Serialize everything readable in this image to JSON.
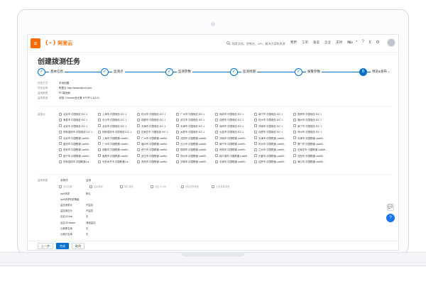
{
  "topbar": {
    "menu_icon": "≡",
    "logo_mark": "(-)",
    "logo_text": "阿里云",
    "search_placeholder": "搜索文档、控制台、API、解决方案和资源",
    "nav": [
      "费用",
      "工单",
      "备案",
      "企业",
      "支持",
      "App"
    ],
    "icons": [
      "message-icon",
      "notification-icon",
      "help-icon",
      "cart-icon",
      "settings-icon"
    ]
  },
  "page": {
    "title": "创建拨测任务"
  },
  "steps": [
    {
      "num": "✓",
      "label": "基本信息",
      "state": "done"
    },
    {
      "num": "✓",
      "label": "监测点",
      "state": "done"
    },
    {
      "num": "✓",
      "label": "监测参数",
      "state": "done"
    },
    {
      "num": "✓",
      "label": "监测周期",
      "state": "done"
    },
    {
      "num": "✓",
      "label": "报警参数",
      "state": "done"
    },
    {
      "num": "6",
      "label": "预览&发布",
      "state": "active"
    }
  ],
  "info": [
    {
      "key": "任务方式",
      "value": "手动创建"
    },
    {
      "key": "任务名称",
      "value": "阿里云 http://www.aliyun.com"
    },
    {
      "key": "监测类型",
      "value": "PC端页面"
    },
    {
      "key": "监测类型",
      "value": "浏览: Chrome全元素 HTTP/1.1(3.0)"
    }
  ],
  "locations_label": "监测点",
  "locations": [
    [
      "北京市 中国电信 IDC 1",
      "上海市 中国电信 IDC 1",
      "杭州市 中国电信 IDC 1",
      "广州市 中国电信 IDC 1",
      "深圳市 中国电信 IDC 1",
      "南宁市 中国电信 IDC 1",
      "昆明市 中国电信 IDC 1"
    ],
    [
      "海县市 中国电信 IDC 1",
      "长沙市 中国电信 IDC 1",
      "成都市 中国电信 IDC 1",
      "武汉市 中国电信 IDC 1",
      "合肥市 中国电信 IDC 1",
      "杭州市 中国电信 IDC 1",
      "福州市 中国电信 IDC 1"
    ],
    [
      "北京市 中国电信 IDC 1",
      "北京市 中国电信 IDC 1",
      "天津市 中国电信 IDC 1",
      "天津市 中国电信 IDC 1",
      "深圳市 中国电信 IDC 1",
      "济南市 中国电信 IDC 1",
      "南宁市 中国电信 IDC 1"
    ],
    [
      "呼和浩特市 中国电信 IDC 1",
      "呼和浩特市 中国电信 IDC 1",
      "石家庄市 中国电信 IDC 1",
      "太原市 中国电信 IDC 1",
      "大连市 中国电信 IDC 1",
      "合肥市 中国电信 IDC 1",
      "郑州市 中国电信 IDC 1"
    ],
    [
      "北京市 中国联通 LastMi...",
      "上海市 中国联通 LastMi...",
      "广州市 中国联通 LastMi...",
      "沈阳市 中国联通 LastMi...",
      "济南市 中国联通 LastMi...",
      "天津市 中国联通 LastMi...",
      "天津市 中国联通 LastMi..."
    ],
    [
      "重庆市 中国联通 LastMi...",
      "广州市 中国联通 LastMi...",
      "福州市 中国联通 LastMi...",
      "长沙市 中国联通 LastMi...",
      "南宁市 中国联通 LastMi...",
      "杭州市 中国联通 LastMi...",
      "厦门市 中国联通 LastMi..."
    ],
    [
      "西安市 中国联通 LastMi...",
      "成都市 中国联通 LastMi...",
      "西宁市 中国联通 LastMi...",
      "昆明市 中国联通 LastMi...",
      "贵阳市 中国联通 LastMi...",
      "兰州市 中国联通 LastMi...",
      "石家庄市 中国联通 LastMi..."
    ],
    [
      "西宁市 中国联通 LastMi...",
      "南昌市 中国联通 LastMi...",
      "武汉市 中国联通 LastMi...",
      "郑州市 中国联通 LastMi...",
      "哈尔滨市 中国联通 LastMi...",
      "长春市 中国联通 LastMi...",
      "沈阳市 中国联通 LastMi..."
    ],
    [
      "呼和浩特市 中国联通 La...",
      "乌鲁木齐市 中国联通 La...",
      "贵阳市 中国联通 LastMi...",
      "济南市 中国联通 LastMi...",
      "天津市 中国联通 LastMi...",
      "拉萨市 中国联通 LastMi...",
      "海口市 中国联通 LastMi..."
    ]
  ],
  "params_label": "监测参数",
  "params_head": [
    "参数项",
    "监测"
  ],
  "param_checks": [
    "显示结果",
    "监测错误",
    "禁止跳转",
    "自定义Host",
    "劫持告警阈值",
    "元素采集错误"
  ],
  "params": [
    {
      "name": "ipv6请求",
      "value": "默认"
    },
    {
      "name": "ipv6请求失败降级",
      "value": ""
    },
    {
      "name": "监控请求头",
      "value": "不监控"
    },
    {
      "name": "监控响应头",
      "value": "不监控"
    },
    {
      "name": "自定义Host",
      "value": "无"
    },
    {
      "name": "自定义Header",
      "value": "请填监控"
    },
    {
      "name": "元素黑名单",
      "value": "无"
    },
    {
      "name": "元素白名单",
      "value": "无"
    }
  ],
  "buttons": {
    "prev": "上一步",
    "create": "完成",
    "cancel": "取消"
  },
  "float": {
    "chat": "💬",
    "help": "?"
  },
  "colors": {
    "brand": "#ff6a00",
    "primary": "#0070cc"
  }
}
